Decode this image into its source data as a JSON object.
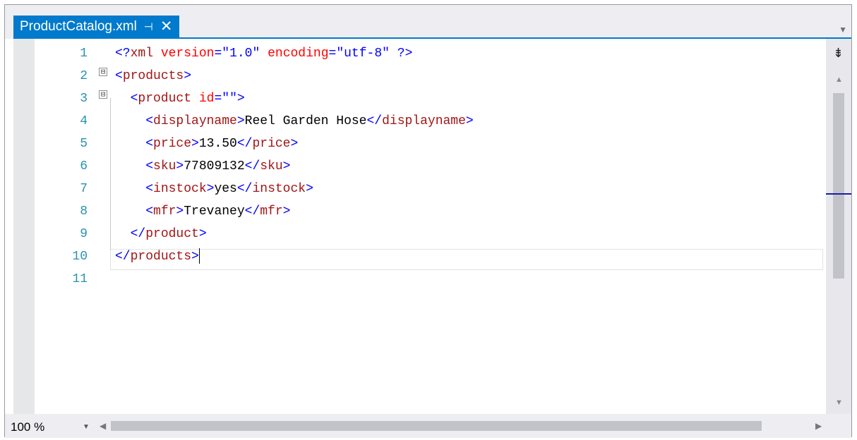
{
  "tab": {
    "title": "ProductCatalog.xml",
    "pin_icon": "⊣",
    "close_icon": "✕"
  },
  "editor": {
    "line_numbers": [
      "1",
      "2",
      "3",
      "4",
      "5",
      "6",
      "7",
      "8",
      "9",
      "10",
      "11"
    ],
    "fold_markers": [
      "⊟",
      "⊟"
    ],
    "lines": [
      [
        {
          "t": "<?",
          "c": "br"
        },
        {
          "t": "xml",
          "c": "tg"
        },
        {
          "t": " ",
          "c": "tx"
        },
        {
          "t": "version",
          "c": "at"
        },
        {
          "t": "=",
          "c": "br"
        },
        {
          "t": "\"1.0\"",
          "c": "st"
        },
        {
          "t": " ",
          "c": "tx"
        },
        {
          "t": "encoding",
          "c": "at"
        },
        {
          "t": "=",
          "c": "br"
        },
        {
          "t": "\"utf-8\"",
          "c": "st"
        },
        {
          "t": " ",
          "c": "tx"
        },
        {
          "t": "?>",
          "c": "br"
        }
      ],
      [
        {
          "t": "<",
          "c": "br"
        },
        {
          "t": "products",
          "c": "tg"
        },
        {
          "t": ">",
          "c": "br"
        }
      ],
      [
        {
          "t": "  <",
          "c": "br"
        },
        {
          "t": "product",
          "c": "tg"
        },
        {
          "t": " ",
          "c": "tx"
        },
        {
          "t": "id",
          "c": "at"
        },
        {
          "t": "=",
          "c": "br"
        },
        {
          "t": "\"\"",
          "c": "st"
        },
        {
          "t": ">",
          "c": "br"
        }
      ],
      [
        {
          "t": "    <",
          "c": "br"
        },
        {
          "t": "displayname",
          "c": "tg"
        },
        {
          "t": ">",
          "c": "br"
        },
        {
          "t": "Reel Garden Hose",
          "c": "tx"
        },
        {
          "t": "</",
          "c": "br"
        },
        {
          "t": "displayname",
          "c": "tg"
        },
        {
          "t": ">",
          "c": "br"
        }
      ],
      [
        {
          "t": "    <",
          "c": "br"
        },
        {
          "t": "price",
          "c": "tg"
        },
        {
          "t": ">",
          "c": "br"
        },
        {
          "t": "13.50",
          "c": "tx"
        },
        {
          "t": "</",
          "c": "br"
        },
        {
          "t": "price",
          "c": "tg"
        },
        {
          "t": ">",
          "c": "br"
        }
      ],
      [
        {
          "t": "    <",
          "c": "br"
        },
        {
          "t": "sku",
          "c": "tg"
        },
        {
          "t": ">",
          "c": "br"
        },
        {
          "t": "77809132",
          "c": "tx"
        },
        {
          "t": "</",
          "c": "br"
        },
        {
          "t": "sku",
          "c": "tg"
        },
        {
          "t": ">",
          "c": "br"
        }
      ],
      [
        {
          "t": "    <",
          "c": "br"
        },
        {
          "t": "instock",
          "c": "tg"
        },
        {
          "t": ">",
          "c": "br"
        },
        {
          "t": "yes",
          "c": "tx"
        },
        {
          "t": "</",
          "c": "br"
        },
        {
          "t": "instock",
          "c": "tg"
        },
        {
          "t": ">",
          "c": "br"
        }
      ],
      [
        {
          "t": "    <",
          "c": "br"
        },
        {
          "t": "mfr",
          "c": "tg"
        },
        {
          "t": ">",
          "c": "br"
        },
        {
          "t": "Trevaney",
          "c": "tx"
        },
        {
          "t": "</",
          "c": "br"
        },
        {
          "t": "mfr",
          "c": "tg"
        },
        {
          "t": ">",
          "c": "br"
        }
      ],
      [
        {
          "t": "  </",
          "c": "br"
        },
        {
          "t": "product",
          "c": "tg"
        },
        {
          "t": ">",
          "c": "br"
        }
      ],
      [
        {
          "t": "</",
          "c": "br"
        },
        {
          "t": "products",
          "c": "tg"
        },
        {
          "t": ">",
          "c": "br"
        }
      ],
      []
    ],
    "caret_line": 10
  },
  "scrollbars": {
    "split_icon": "⇟",
    "up_icon": "▲",
    "down_icon": "▼",
    "left_icon": "◀",
    "right_icon": "▶"
  },
  "status": {
    "zoom": "100 %",
    "zoom_dropdown_icon": "▼"
  },
  "colors": {
    "accent": "#007acc",
    "tag": "#a31515",
    "attribute": "#ff0000",
    "string": "#0000ff",
    "line_number": "#2b91af"
  }
}
